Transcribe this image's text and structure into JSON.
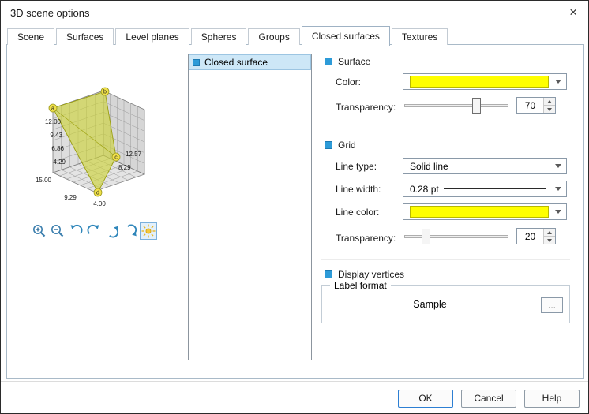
{
  "window": {
    "title": "3D scene options",
    "close_glyph": "×"
  },
  "tabs": [
    {
      "label": "Scene",
      "active": false
    },
    {
      "label": "Surfaces",
      "active": false
    },
    {
      "label": "Level planes",
      "active": false
    },
    {
      "label": "Spheres",
      "active": false
    },
    {
      "label": "Groups",
      "active": false
    },
    {
      "label": "Closed surfaces",
      "active": true
    },
    {
      "label": "Textures",
      "active": false
    }
  ],
  "preview": {
    "axis_left": [
      "12.00",
      "9.43",
      "6.86",
      "4.29"
    ],
    "axis_bottom": [
      "15.00",
      "9.29",
      "4.00"
    ],
    "axis_right": [
      "12.57",
      "8.29"
    ],
    "points": [
      "a",
      "b",
      "c",
      "d"
    ],
    "surface_fill": "#cdd23c",
    "toolbar": [
      "zoom-in",
      "zoom-out",
      "rotate-left",
      "rotate-right",
      "tilt-left",
      "tilt-right",
      "lighting"
    ]
  },
  "list": {
    "items": [
      {
        "label": "Closed surface",
        "selected": true
      }
    ]
  },
  "surface_section": {
    "title": "Surface",
    "color_label": "Color:",
    "color_value": "#FFFF00",
    "transparency_label": "Transparency:",
    "transparency_value": "70"
  },
  "grid_section": {
    "title": "Grid",
    "line_type_label": "Line type:",
    "line_type_value": "Solid line",
    "line_width_label": "Line width:",
    "line_width_value": "0.28 pt",
    "line_color_label": "Line color:",
    "line_color_value": "#FFFF00",
    "transparency_label": "Transparency:",
    "transparency_value": "20"
  },
  "vertices_section": {
    "label": "Display vertices"
  },
  "label_format": {
    "title": "Label format",
    "sample_text": "Sample",
    "more_button": "..."
  },
  "footer": {
    "ok_label": "OK",
    "cancel_label": "Cancel",
    "help_label": "Help"
  },
  "accent_colors": {
    "checkbox_blue": "#2d9bd8",
    "selection_bg": "#cde7f7",
    "slider_values": [
      70,
      20
    ]
  }
}
